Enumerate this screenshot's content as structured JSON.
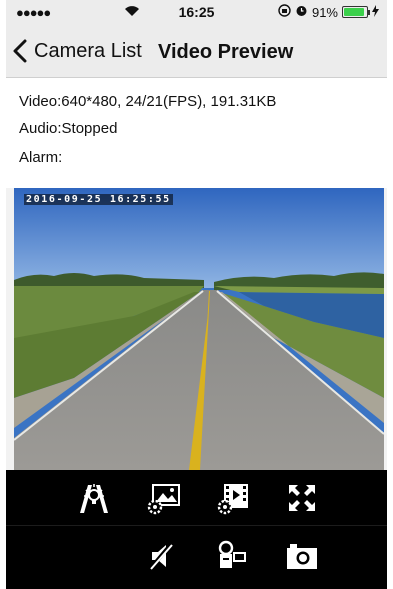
{
  "status_bar": {
    "signal": "●●●●●",
    "time": "16:25",
    "battery_percent": "91%",
    "battery_level": 0.91,
    "icons": [
      "wifi-icon",
      "orientation-lock-icon",
      "alarm-icon",
      "battery-icon",
      "charging-icon"
    ]
  },
  "nav": {
    "back_label": "Camera List",
    "title": "Video Preview"
  },
  "info": {
    "video": "Video:640*480, 24/21(FPS), 191.31KB",
    "audio": "Audio:Stopped",
    "alarm": "Alarm:"
  },
  "video": {
    "timestamp": "2016-09-25  16:25:55"
  },
  "controls": {
    "row1": [
      "night-vision-icon",
      "image-settings-icon",
      "video-settings-icon",
      "fullscreen-icon"
    ],
    "row2": [
      "mute-icon",
      "record-icon",
      "snapshot-icon"
    ]
  },
  "colors": {
    "control_bar": "#000000",
    "battery_fill": "#3bd04b",
    "nav_bar": "#ececec"
  }
}
